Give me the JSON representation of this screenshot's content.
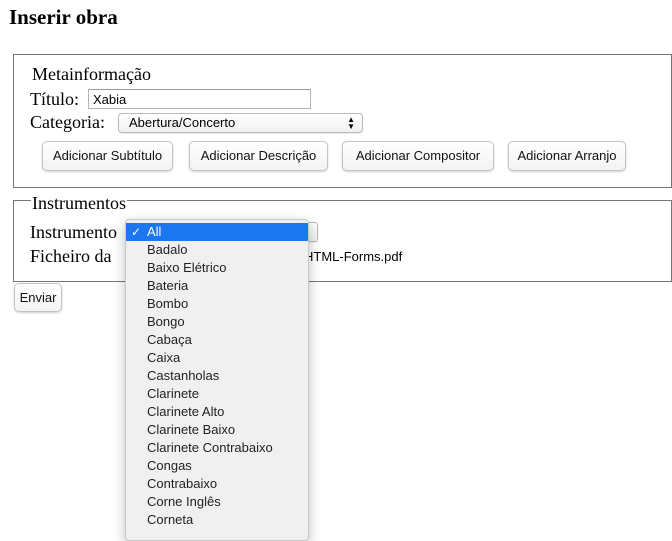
{
  "page": {
    "title": "Inserir obra"
  },
  "meta": {
    "legend": "Metainformação",
    "titulo_label": "Título:",
    "titulo_value": "Xabia",
    "categoria_label": "Categoria:",
    "categoria_value": "Abertura/Concerto",
    "buttons": [
      "Adicionar Subtítulo",
      "Adicionar Descrição",
      "Adicionar Compositor",
      "Adicionar Arranjo"
    ]
  },
  "instruments": {
    "legend": "Instrumentos",
    "instrumento_label": "Instrumento",
    "ficheiro_label": "Ficheiro da",
    "file_name_fragment": "HTML-Forms.pdf",
    "selected_option": "All",
    "options": [
      "All",
      "Badalo",
      "Baixo Elétrico",
      "Bateria",
      "Bombo",
      "Bongo",
      "Cabaça",
      "Caixa",
      "Castanholas",
      "Clarinete",
      "Clarinete Alto",
      "Clarinete Baixo",
      "Clarinete Contrabaixo",
      "Congas",
      "Contrabaixo",
      "Corne Inglês",
      "Corneta"
    ]
  },
  "submit_label": "Enviar",
  "colors": {
    "highlight": "#1c76f0",
    "menu_bg": "#f0f0f0",
    "border": "#777777"
  },
  "icons": {
    "checkmark": "checkmark-icon",
    "select_arrows": "select-arrows-icon"
  }
}
